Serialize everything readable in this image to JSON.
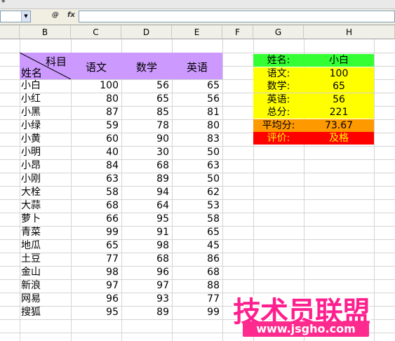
{
  "window": {
    "title": "* "
  },
  "formula_bar": {
    "name_box": "",
    "fx_label": "fx",
    "insert_fn_label": "@",
    "formula": ""
  },
  "columns": [
    "B",
    "C",
    "D",
    "E",
    "F",
    "G",
    "H"
  ],
  "table": {
    "header_subject": "科目",
    "header_name": "姓名",
    "subjects": [
      "语文",
      "数学",
      "英语"
    ],
    "rows": [
      {
        "name": "小白",
        "scores": [
          100,
          56,
          65
        ]
      },
      {
        "name": "小红",
        "scores": [
          80,
          65,
          56
        ]
      },
      {
        "name": "小黑",
        "scores": [
          87,
          85,
          81
        ]
      },
      {
        "name": "小绿",
        "scores": [
          59,
          78,
          80
        ]
      },
      {
        "name": "小黄",
        "scores": [
          60,
          90,
          83
        ]
      },
      {
        "name": "小明",
        "scores": [
          40,
          30,
          50
        ]
      },
      {
        "name": "小昂",
        "scores": [
          84,
          68,
          63
        ]
      },
      {
        "name": "小刚",
        "scores": [
          63,
          89,
          50
        ]
      },
      {
        "name": "大栓",
        "scores": [
          58,
          94,
          62
        ]
      },
      {
        "name": "大蒜",
        "scores": [
          68,
          64,
          53
        ]
      },
      {
        "name": "萝卜",
        "scores": [
          66,
          95,
          58
        ]
      },
      {
        "name": "青菜",
        "scores": [
          99,
          91,
          65
        ]
      },
      {
        "name": "地瓜",
        "scores": [
          65,
          98,
          45
        ]
      },
      {
        "name": "土豆",
        "scores": [
          77,
          68,
          86
        ]
      },
      {
        "name": "金山",
        "scores": [
          98,
          96,
          68
        ]
      },
      {
        "name": "新浪",
        "scores": [
          97,
          97,
          88
        ]
      },
      {
        "name": "网易",
        "scores": [
          96,
          93,
          77
        ]
      },
      {
        "name": "搜狐",
        "scores": [
          95,
          89,
          99
        ]
      }
    ]
  },
  "panel": {
    "rows": [
      {
        "label": "姓名:",
        "value": "小白",
        "bg": "#33ff33",
        "fg": "#000000"
      },
      {
        "label": "语文:",
        "value": "100",
        "bg": "#ffff00",
        "fg": "#000000"
      },
      {
        "label": "数学:",
        "value": "65",
        "bg": "#ffff00",
        "fg": "#000000"
      },
      {
        "label": "英语:",
        "value": "56",
        "bg": "#ffff00",
        "fg": "#000000"
      },
      {
        "label": "总分:",
        "value": "221",
        "bg": "#ffff00",
        "fg": "#000000"
      },
      {
        "label": "平均分:",
        "value": "73.67",
        "bg": "#ff9900",
        "fg": "#000000"
      },
      {
        "label": "评价:",
        "value": "及格",
        "bg": "#ff0000",
        "fg": "#ffff00"
      }
    ]
  },
  "watermark": {
    "title": "技术员联盟",
    "url": "www.jsgho.com"
  }
}
